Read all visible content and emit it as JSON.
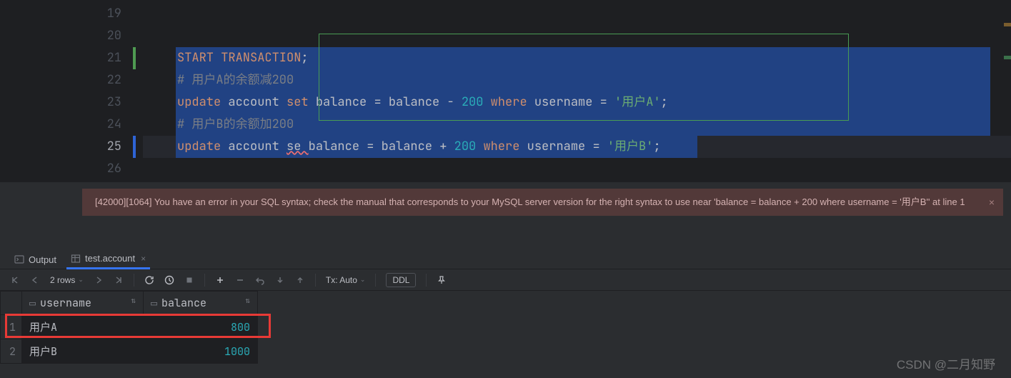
{
  "editor": {
    "lines": [
      {
        "n": 19,
        "modified": false
      },
      {
        "n": 20,
        "modified": false
      },
      {
        "n": 21,
        "modified": true
      },
      {
        "n": 22,
        "modified": false
      },
      {
        "n": 23,
        "modified": false
      },
      {
        "n": 24,
        "modified": false
      },
      {
        "n": 25,
        "modified": false,
        "current": true
      },
      {
        "n": 26,
        "modified": false
      }
    ],
    "code": {
      "l21_start": "START",
      "l21_tx": " TRANSACTION",
      "l21_semi": ";",
      "l22": "# 用户A的余额减200",
      "l23_update": "update",
      "l23_account": " account ",
      "l23_set": "set",
      "l23_bal1": " balance ",
      "l23_eq": "=",
      "l23_bal2": " balance ",
      "l23_minus": "-",
      "l23_num": " 200 ",
      "l23_where": "where",
      "l23_user": " username ",
      "l23_eq2": "=",
      "l23_str": " '用户A'",
      "l23_semi": ";",
      "l24": "# 用户B的余额加200",
      "l25_update": "update",
      "l25_account": " account ",
      "l25_se": "se ",
      "l25_bal1": "balance ",
      "l25_eq": "=",
      "l25_bal2": " balance ",
      "l25_plus": "+",
      "l25_num": " 200 ",
      "l25_where": "where",
      "l25_user": " username ",
      "l25_eq2": "=",
      "l25_str": " '用户B'",
      "l25_semi": ";"
    }
  },
  "error": {
    "message": "[42000][1064] You have an error in your SQL syntax; check the manual that corresponds to your MySQL server version for the right syntax to use near 'balance = balance + 200 where username = '用户B'' at line 1"
  },
  "tabs": {
    "output": "Output",
    "table": "test.account"
  },
  "toolbar": {
    "rows": "2 rows",
    "tx": "Tx: Auto",
    "ddl": "DDL"
  },
  "columns": {
    "c1": "username",
    "c2": "balance"
  },
  "rows": [
    {
      "idx": "1",
      "username": "用户A",
      "balance": "800"
    },
    {
      "idx": "2",
      "username": "用户B",
      "balance": "1000"
    }
  ],
  "watermark": "CSDN @二月知野"
}
